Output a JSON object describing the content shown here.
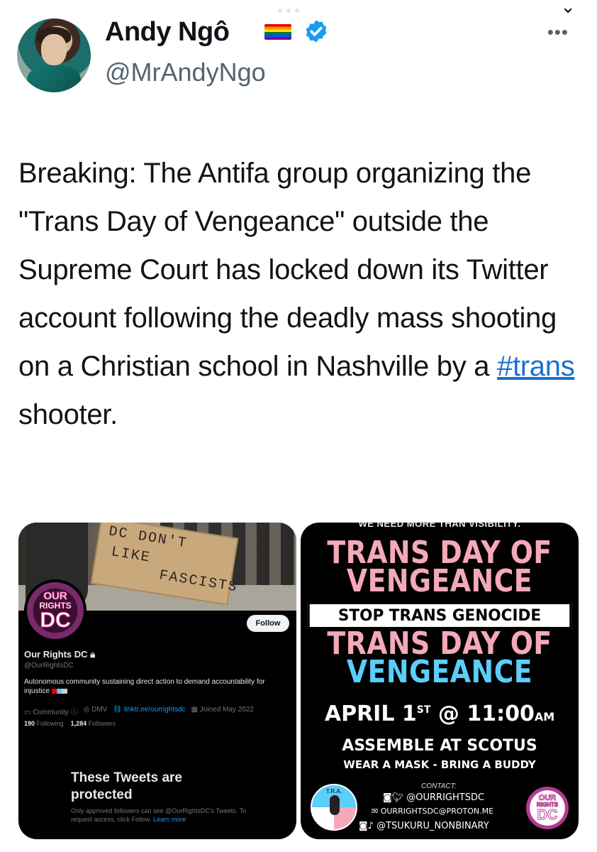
{
  "tweet": {
    "author_name": "Andy Ngô",
    "handle": "@MrAndyNgo",
    "text_parts": [
      "Breaking: The Antifa group organizing the \"Trans Day of Vengeance\" outside the Supreme Court has locked down its Twitter account following the deadly mass shooting on a Christian school in Nashville by a ",
      "#trans",
      " shooter."
    ],
    "more_label": "•••"
  },
  "profile_screenshot": {
    "sign_lines": [
      "DC DON'T",
      "LIKE",
      "FASCISTS"
    ],
    "logo_lines": [
      "OUR",
      "RIGHTS",
      "DC"
    ],
    "follow_label": "Follow",
    "name": "Our Rights DC",
    "handle": "@OurRightsDC",
    "bio": "Autonomous community sustaining direct action to demand accountability for injustice",
    "meta": {
      "category": "Community",
      "location": "DMV",
      "link": "linktr.ee/ourrightsdc",
      "joined": "Joined May 2022"
    },
    "stats": {
      "following_count": "190",
      "following_label": "Following",
      "followers_count": "1,284",
      "followers_label": "Followers"
    },
    "protected_title": "These Tweets are protected",
    "protected_text": "Only approved followers can see @OurRightsDC's Tweets. To request access, click Follow.",
    "protected_link": "Learn more"
  },
  "poster": {
    "top_text": "WE NEED MORE THAN VISIBILITY.",
    "headline": "TRANS DAY OF",
    "headline2": "VENGEANCE",
    "stop_text": "STOP TRANS GENOCIDE",
    "date": "APRIL 1",
    "date_suffix": "ST",
    "time": "@ 11:00",
    "time_suffix": "AM",
    "assemble": "ASSEMBLE AT SCOTUS",
    "wear": "WEAR A MASK  -  BRING A BUDDY",
    "contact_label": "CONTACT:",
    "contact_social": "@OURRIGHTSDC",
    "contact_email": "OURRIGHTSDC@PROTON.ME",
    "contact_other": "@TSUKURU_NONBINARY",
    "tra_text": "T.R.A.",
    "logo_lines": [
      "OUR",
      "RIGHTS",
      "DC"
    ]
  },
  "colors": {
    "link_blue": "#1d6fd0",
    "trans_pink": "#f5a9b8",
    "trans_blue": "#5bcefa"
  },
  "icons": [
    "pride-flag-icon",
    "verified-badge-icon",
    "more-options-icon",
    "lock-icon",
    "instagram-icon",
    "twitter-icon",
    "mail-icon",
    "tiktok-icon"
  ]
}
